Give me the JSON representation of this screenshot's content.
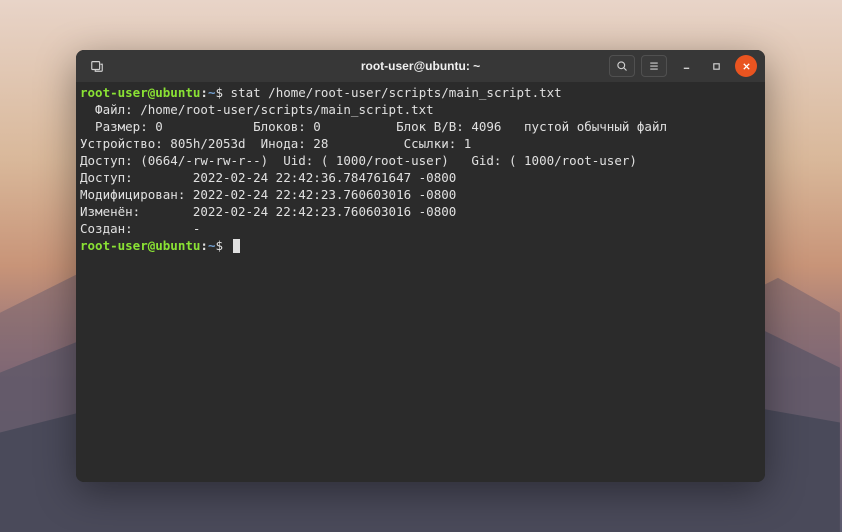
{
  "window": {
    "title": "root-user@ubuntu: ~"
  },
  "prompt": {
    "user_host": "root-user@ubuntu",
    "colon": ":",
    "path": "~",
    "symbol": "$"
  },
  "command": "stat /home/root-user/scripts/main_script.txt",
  "output": {
    "line_file": "  Файл: /home/root-user/scripts/main_script.txt",
    "line_size": "  Размер: 0            Блоков: 0          Блок В/В: 4096   пустой обычный файл",
    "line_device": "Устройство: 805h/2053d  Инода: 28          Ссылки: 1",
    "line_access": "Доступ: (0664/-rw-rw-r--)  Uid: ( 1000/root-user)   Gid: ( 1000/root-user)",
    "line_atime": "Доступ:        2022-02-24 22:42:36.784761647 -0800",
    "line_mtime": "Модифицирован: 2022-02-24 22:42:23.760603016 -0800",
    "line_ctime": "Изменён:       2022-02-24 22:42:23.760603016 -0800",
    "line_birth": "Создан:        -"
  }
}
